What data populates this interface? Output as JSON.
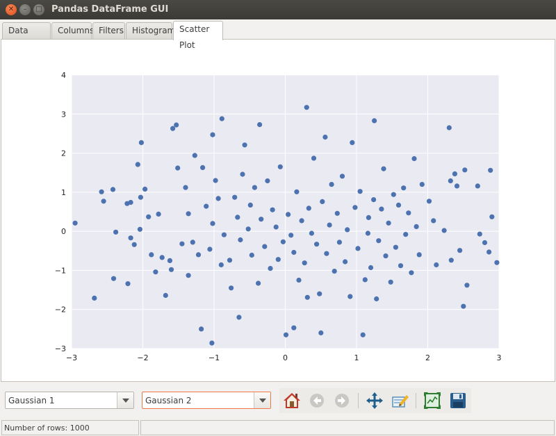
{
  "window": {
    "title": "Pandas DataFrame GUI",
    "controls": [
      "close",
      "minimize",
      "maximize"
    ]
  },
  "tabs": [
    {
      "label": "Data Frame",
      "active": false
    },
    {
      "label": "Columns",
      "active": false
    },
    {
      "label": "Filters",
      "active": false
    },
    {
      "label": "Histogram",
      "active": false
    },
    {
      "label": "Scatter Plot",
      "active": true
    }
  ],
  "controls": {
    "x_column": {
      "selected": "Gaussian 1"
    },
    "y_column": {
      "selected": "Gaussian 2"
    }
  },
  "plot_toolbar": [
    {
      "name": "home-icon",
      "enabled": true
    },
    {
      "name": "back-icon",
      "enabled": false
    },
    {
      "name": "forward-icon",
      "enabled": false
    },
    {
      "name": "pan-icon",
      "enabled": true
    },
    {
      "name": "configure-subplots-icon",
      "enabled": true
    },
    {
      "name": "zoom-icon",
      "enabled": true
    },
    {
      "name": "save-icon",
      "enabled": true
    }
  ],
  "status": {
    "rows_text": "Number of rows: 1000"
  },
  "colors": {
    "plot_background": "#eaeaf2",
    "grid": "#ffffff",
    "marker": "#4c72b0",
    "titlebar": "#3d3c38",
    "accent": "#f07746"
  },
  "chart_data": {
    "type": "scatter",
    "xlim": [
      -3,
      3
    ],
    "ylim": [
      -3,
      4
    ],
    "xticks": [
      "−3",
      "−2",
      "−1",
      "0",
      "1",
      "2",
      "3"
    ],
    "xtick_values": [
      -3,
      -2,
      -1,
      0,
      1,
      2,
      3
    ],
    "yticks": [
      "−3",
      "−2",
      "−1",
      "0",
      "1",
      "2",
      "3",
      "4"
    ],
    "ytick_values": [
      -3,
      -2,
      -1,
      0,
      1,
      2,
      3,
      4
    ],
    "grid": true,
    "point_count": 1000,
    "distribution": "bivariate standard normal",
    "points": [
      [
        -2.95,
        0.21
      ],
      [
        -2.68,
        -1.71
      ],
      [
        -2.58,
        1.01
      ],
      [
        -2.55,
        0.77
      ],
      [
        -2.42,
        1.07
      ],
      [
        -2.41,
        -1.21
      ],
      [
        -2.38,
        -0.02
      ],
      [
        -2.21,
        -1.34
      ],
      [
        -2.22,
        0.71
      ],
      [
        -2.17,
        0.74
      ],
      [
        -2.17,
        -0.17
      ],
      [
        -2.12,
        -0.34
      ],
      [
        -2.07,
        1.71
      ],
      [
        -2.02,
        2.27
      ],
      [
        -2.03,
        0.87
      ],
      [
        -2.04,
        0.05
      ],
      [
        -1.97,
        1.08
      ],
      [
        -1.92,
        0.37
      ],
      [
        -1.88,
        -0.6
      ],
      [
        -1.82,
        -1.04
      ],
      [
        -1.78,
        0.44
      ],
      [
        -1.73,
        -0.67
      ],
      [
        -1.68,
        -1.64
      ],
      [
        -1.62,
        -0.75
      ],
      [
        -1.6,
        -0.98
      ],
      [
        -1.58,
        2.63
      ],
      [
        -1.53,
        2.72
      ],
      [
        -1.51,
        1.62
      ],
      [
        -1.45,
        -0.32
      ],
      [
        -1.4,
        1.12
      ],
      [
        -1.36,
        0.45
      ],
      [
        -1.36,
        -1.13
      ],
      [
        -1.3,
        -0.28
      ],
      [
        -1.27,
        1.94
      ],
      [
        -1.22,
        -0.6
      ],
      [
        -1.18,
        -2.5
      ],
      [
        -1.16,
        1.63
      ],
      [
        -1.11,
        0.64
      ],
      [
        -1.06,
        -0.46
      ],
      [
        -1.02,
        0.2
      ],
      [
        -0.98,
        1.3
      ],
      [
        -0.94,
        0.84
      ],
      [
        -0.9,
        -0.86
      ],
      [
        -0.86,
        -0.09
      ],
      [
        -1.02,
        2.47
      ],
      [
        -0.89,
        2.88
      ],
      [
        -1.03,
        -2.86
      ],
      [
        -0.78,
        -0.74
      ],
      [
        -0.76,
        -1.45
      ],
      [
        -0.71,
        0.87
      ],
      [
        -0.67,
        0.36
      ],
      [
        -0.63,
        -0.22
      ],
      [
        -0.65,
        -2.2
      ],
      [
        -0.6,
        1.46
      ],
      [
        -0.57,
        2.21
      ],
      [
        -0.52,
        0.06
      ],
      [
        -0.49,
        0.67
      ],
      [
        -0.47,
        -0.61
      ],
      [
        -0.43,
        1.12
      ],
      [
        -0.36,
        2.73
      ],
      [
        -0.38,
        -1.33
      ],
      [
        -0.34,
        0.31
      ],
      [
        -0.29,
        -0.39
      ],
      [
        -0.25,
        1.29
      ],
      [
        -0.21,
        -0.95
      ],
      [
        -0.18,
        0.55
      ],
      [
        -0.13,
        0.11
      ],
      [
        -0.1,
        -0.72
      ],
      [
        -0.07,
        1.65
      ],
      [
        -0.03,
        -0.27
      ],
      [
        0.01,
        -2.65
      ],
      [
        0.04,
        0.43
      ],
      [
        0.08,
        -0.1
      ],
      [
        0.12,
        -0.54
      ],
      [
        0.12,
        -2.47
      ],
      [
        0.16,
        1.01
      ],
      [
        0.19,
        -1.25
      ],
      [
        0.23,
        0.27
      ],
      [
        0.27,
        -0.81
      ],
      [
        0.3,
        3.17
      ],
      [
        0.31,
        -1.69
      ],
      [
        0.33,
        0.59
      ],
      [
        0.37,
        -0.05
      ],
      [
        0.4,
        1.87
      ],
      [
        0.44,
        -0.33
      ],
      [
        0.48,
        -1.6
      ],
      [
        0.5,
        -2.6
      ],
      [
        0.52,
        0.76
      ],
      [
        0.56,
        2.41
      ],
      [
        0.58,
        -0.57
      ],
      [
        0.62,
        0.16
      ],
      [
        0.65,
        1.2
      ],
      [
        0.69,
        -1.02
      ],
      [
        0.73,
        0.46
      ],
      [
        0.76,
        -0.28
      ],
      [
        0.8,
        1.41
      ],
      [
        0.84,
        -0.78
      ],
      [
        0.87,
        0.04
      ],
      [
        0.91,
        -1.67
      ],
      [
        0.94,
        2.27
      ],
      [
        0.98,
        0.61
      ],
      [
        1.02,
        -0.44
      ],
      [
        1.05,
        1.02
      ],
      [
        1.09,
        -2.65
      ],
      [
        1.12,
        -1.24
      ],
      [
        1.16,
        -0.05
      ],
      [
        1.17,
        0.35
      ],
      [
        1.2,
        -0.93
      ],
      [
        1.24,
        0.81
      ],
      [
        1.25,
        2.83
      ],
      [
        1.28,
        -1.73
      ],
      [
        1.31,
        -0.24
      ],
      [
        1.35,
        0.57
      ],
      [
        1.38,
        1.6
      ],
      [
        1.41,
        -0.63
      ],
      [
        1.45,
        0.21
      ],
      [
        1.48,
        -1.3
      ],
      [
        1.52,
        0.94
      ],
      [
        1.55,
        -0.41
      ],
      [
        1.59,
        0.67
      ],
      [
        1.62,
        -0.88
      ],
      [
        1.66,
        1.11
      ],
      [
        1.69,
        -0.08
      ],
      [
        1.73,
        0.47
      ],
      [
        1.77,
        -1.06
      ],
      [
        1.81,
        1.86
      ],
      [
        1.84,
        0.12
      ],
      [
        1.88,
        -0.6
      ],
      [
        1.92,
        1.2
      ],
      [
        2.02,
        0.77
      ],
      [
        2.08,
        0.27
      ],
      [
        2.12,
        -0.86
      ],
      [
        2.23,
        0.02
      ],
      [
        2.32,
        1.29
      ],
      [
        2.33,
        -0.74
      ],
      [
        2.3,
        2.65
      ],
      [
        2.38,
        1.47
      ],
      [
        2.41,
        1.16
      ],
      [
        2.45,
        -0.49
      ],
      [
        2.52,
        1.57
      ],
      [
        2.55,
        -1.38
      ],
      [
        2.5,
        -1.92
      ],
      [
        2.7,
        1.16
      ],
      [
        2.73,
        -0.07
      ],
      [
        2.8,
        -0.29
      ],
      [
        2.86,
        -0.53
      ],
      [
        2.88,
        1.56
      ],
      [
        2.9,
        0.37
      ],
      [
        2.97,
        -0.8
      ]
    ]
  }
}
